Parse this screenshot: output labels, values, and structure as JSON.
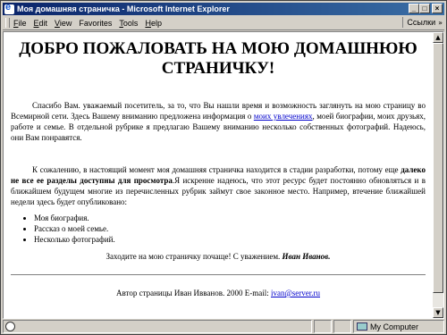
{
  "window": {
    "title": "Моя домашняя страничка - Microsoft Internet Explorer",
    "minimize": "_",
    "maximize": "□",
    "close": "×"
  },
  "menu": {
    "items": [
      {
        "key": "F",
        "rest": "ile"
      },
      {
        "key": "E",
        "rest": "dit"
      },
      {
        "key": "V",
        "rest": "iew"
      },
      {
        "key": "",
        "rest": "Favorites"
      },
      {
        "key": "T",
        "rest": "ools"
      },
      {
        "key": "H",
        "rest": "elp"
      }
    ],
    "links_label": "Ссылки",
    "links_arrow": "»"
  },
  "page": {
    "heading": "ДОБРО ПОЖАЛОВАТЬ НА МОЮ ДОМАШНЮЮ СТРАНИЧКУ!",
    "para1_before": "Спасибо Вам. уважаемый посетитель, за то, что Вы нашли время и возможность заглянуть на мою страницу во Всемирной сети. Здесь Вашему вниманию предложена информация о ",
    "para1_link": "моих увлечениях",
    "para1_after": ", моей биографии, моих друзьях, работе и семье. В отдельной рубрике я предлагаю Вашему вниманию несколько собственных фотографий. Надеюсь, они Вам понравятся.",
    "para2_before": "К сожалению, в настоящий момент моя домашняя страничка находится в стадии разработки, потому еще ",
    "para2_bold": "далеко не все ее разделы доступны для просмотра",
    "para2_after": ".Я искренне надеюсь, что этот ресурс будет постоянно обновляться и в ближайшем будущем многие из перечисленных рубрик займут свое законное место. Например, втечение ближайшей недели здесь будет опубликовано:",
    "list": [
      "Моя биография.",
      "Рассказ о моей семье.",
      "Несколько фотографий."
    ],
    "closing_text": "Заходите на мою страничку почаще! С уважением. ",
    "closing_name": "Иван Иванов.",
    "footer_text": "Автор страницы Иван Ивванов. 2000 E-mail: ",
    "footer_email": "ivan@server.ru"
  },
  "status": {
    "zone": "My Computer"
  }
}
